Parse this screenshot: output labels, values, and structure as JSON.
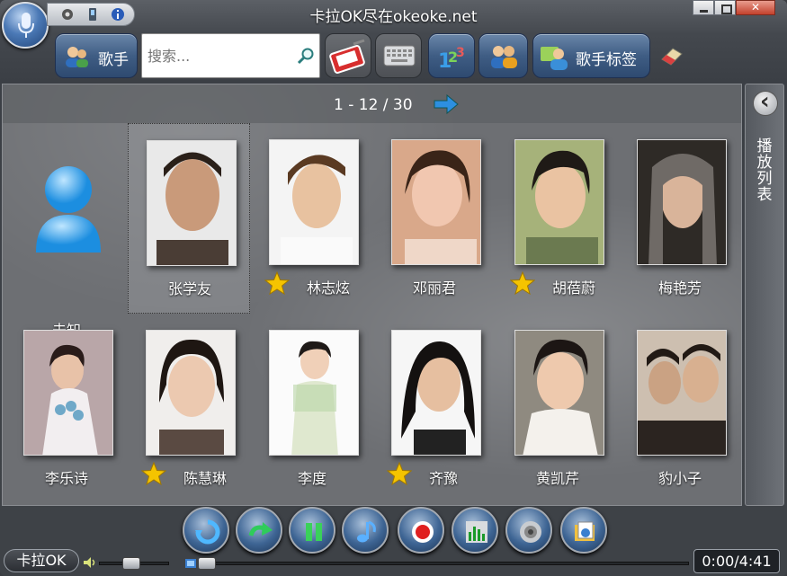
{
  "window": {
    "title": "卡拉OK尽在okeoke.net"
  },
  "toolbar": {
    "singer_label": "歌手",
    "search_placeholder": "搜索...",
    "singer_tags_label": "歌手标签"
  },
  "pager": {
    "text": "1  - 12 / 30"
  },
  "artists": [
    {
      "name": "未知",
      "starred": false,
      "selected": false
    },
    {
      "name": "张学友",
      "starred": false,
      "selected": true
    },
    {
      "name": "林志炫",
      "starred": true,
      "selected": false
    },
    {
      "name": "邓丽君",
      "starred": false,
      "selected": false
    },
    {
      "name": "胡蓓蔚",
      "starred": true,
      "selected": false
    },
    {
      "name": "梅艳芳",
      "starred": false,
      "selected": false
    },
    {
      "name": "李乐诗",
      "starred": false,
      "selected": false
    },
    {
      "name": "陈慧琳",
      "starred": true,
      "selected": false
    },
    {
      "name": "李度",
      "starred": false,
      "selected": false
    },
    {
      "name": "齐豫",
      "starred": true,
      "selected": false
    },
    {
      "name": "黄凯芹",
      "starred": false,
      "selected": false
    },
    {
      "name": "豹小子",
      "starred": false,
      "selected": false
    }
  ],
  "sidebar": {
    "playlist_label": "播放列表"
  },
  "statusbar": {
    "mode_label": "卡拉OK",
    "time": "0:00/4:41",
    "volume_level": 0.45,
    "progress_level": 0.0
  },
  "colors": {
    "accent": "#3f5d84",
    "star": "#f5c400"
  }
}
